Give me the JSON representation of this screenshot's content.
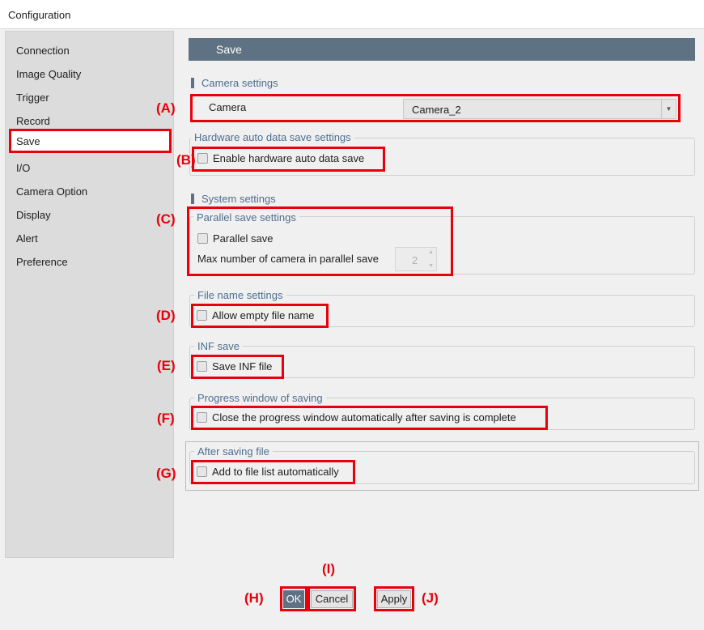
{
  "window": {
    "title": "Configuration"
  },
  "sidebar": {
    "items": [
      {
        "label": "Connection"
      },
      {
        "label": "Image Quality"
      },
      {
        "label": "Trigger"
      },
      {
        "label": "Record"
      },
      {
        "label": "Save",
        "selected": true
      },
      {
        "label": "I/O"
      },
      {
        "label": "Camera Option"
      },
      {
        "label": "Display"
      },
      {
        "label": "Alert"
      },
      {
        "label": "Preference"
      }
    ]
  },
  "page": {
    "title": "Save"
  },
  "camera_settings": {
    "section_title": "Camera settings",
    "camera_label": "Camera",
    "camera_value": "Camera_2"
  },
  "hardware_auto": {
    "group_title": "Hardware auto data save settings",
    "checkbox_label": "Enable hardware auto data save",
    "checked": false
  },
  "system_settings": {
    "section_title": "System settings"
  },
  "parallel_save": {
    "group_title": "Parallel save settings",
    "checkbox_label": "Parallel save",
    "checked": false,
    "max_label": "Max number of camera in parallel save",
    "max_value": "2"
  },
  "file_name": {
    "group_title": "File name settings",
    "checkbox_label": "Allow empty file name",
    "checked": false
  },
  "inf_save": {
    "group_title": "INF save",
    "checkbox_label": "Save INF file",
    "checked": false
  },
  "progress_window": {
    "group_title": "Progress window of saving",
    "checkbox_label": "Close the progress window automatically after saving is complete",
    "checked": false
  },
  "after_saving": {
    "group_title": "After saving file",
    "checkbox_label": "Add to file list automatically",
    "checked": false
  },
  "buttons": {
    "ok": "OK",
    "cancel": "Cancel",
    "apply": "Apply"
  },
  "markers": {
    "a": "(A)",
    "b": "(B)",
    "c": "(C)",
    "d": "(D)",
    "e": "(E)",
    "f": "(F)",
    "g": "(G)",
    "h": "(H)",
    "i": "(I)",
    "j": "(J)"
  },
  "colors": {
    "highlight": "#e8000b",
    "header": "#5e7283",
    "section_text": "#4e6e8f"
  }
}
